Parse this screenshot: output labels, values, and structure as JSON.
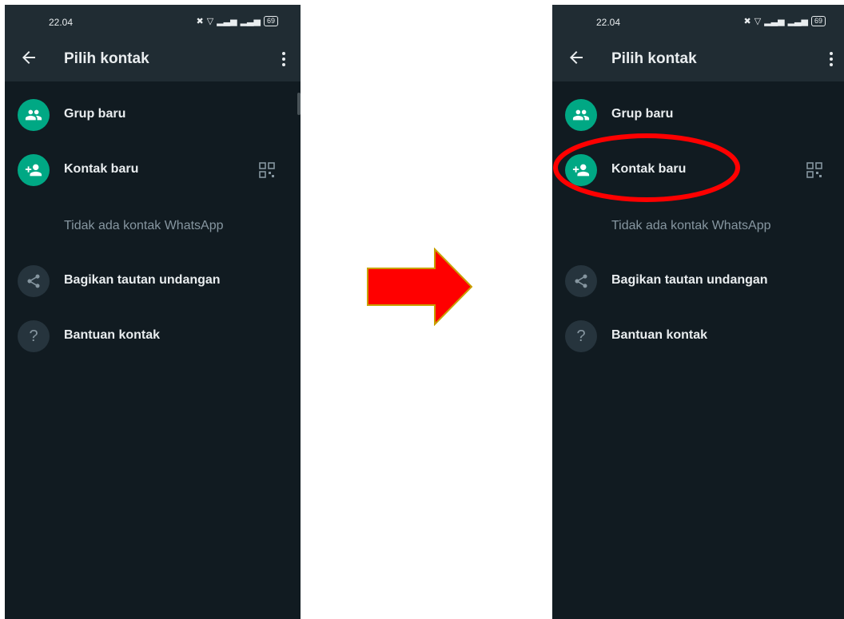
{
  "screens": [
    {
      "status": {
        "time": "22.04",
        "battery": "69"
      },
      "header": {
        "title": "Pilih kontak"
      },
      "items": [
        {
          "label": "Grup baru"
        },
        {
          "label": "Kontak baru"
        },
        {
          "label": "Bagikan tautan undangan"
        },
        {
          "label": "Bantuan kontak"
        }
      ],
      "empty_hint": "Tidak ada kontak WhatsApp"
    },
    {
      "status": {
        "time": "22.04",
        "battery": "69"
      },
      "header": {
        "title": "Pilih kontak"
      },
      "items": [
        {
          "label": "Grup baru"
        },
        {
          "label": "Kontak baru"
        },
        {
          "label": "Bagikan tautan undangan"
        },
        {
          "label": "Bantuan kontak"
        }
      ],
      "empty_hint": "Tidak ada kontak WhatsApp"
    }
  ],
  "icons": {
    "back": "arrow-left-icon",
    "menu": "more-vertical-icon",
    "group": "group-icon",
    "add_contact": "person-add-icon",
    "qr": "qr-code-icon",
    "share": "share-icon",
    "help": "help-icon",
    "question_glyph": "?"
  },
  "colors": {
    "background": "#111b21",
    "header": "#202c33",
    "accent": "#00a884",
    "highlight": "#ff0000",
    "arrow": "#ff0000",
    "arrow_outline": "#c8a000"
  }
}
